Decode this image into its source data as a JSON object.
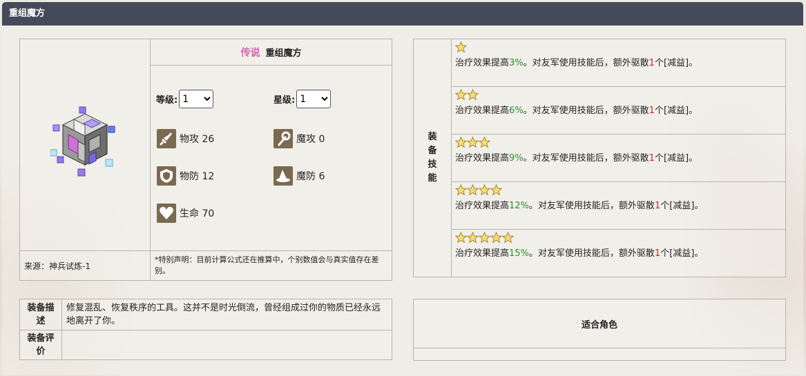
{
  "header": {
    "title": "重组魔方"
  },
  "item": {
    "rarity": "传说",
    "name": "重组魔方",
    "level_label": "等级:",
    "level_value": "1",
    "star_label": "星级:",
    "star_value": "1",
    "stats": {
      "patk": "物攻 26",
      "matk": "魔攻 0",
      "pdef": "物防 12",
      "mdef": "魔防 6",
      "hp": "生命 70"
    },
    "source": "来源：神兵试炼-1",
    "note": "*特别声明：目前计算公式还在推算中，个别数值会与真实值存在差别。"
  },
  "skills": {
    "label": "装备技能",
    "rows": [
      {
        "stars": 1,
        "prefix": "治疗效果提高",
        "pct": "3%",
        "middle": "。对友军使用技能后，额外驱散",
        "count": "1",
        "suffix": "个[减益]。"
      },
      {
        "stars": 2,
        "prefix": "治疗效果提高",
        "pct": "6%",
        "middle": "。对友军使用技能后，额外驱散",
        "count": "1",
        "suffix": "个[减益]。"
      },
      {
        "stars": 3,
        "prefix": "治疗效果提高",
        "pct": "9%",
        "middle": "。对友军使用技能后，额外驱散",
        "count": "1",
        "suffix": "个[减益]。"
      },
      {
        "stars": 4,
        "prefix": "治疗效果提高",
        "pct": "12%",
        "middle": "。对友军使用技能后，额外驱散",
        "count": "1",
        "suffix": "个[减益]。"
      },
      {
        "stars": 5,
        "prefix": "治疗效果提高",
        "pct": "15%",
        "middle": "。对友军使用技能后，额外驱散",
        "count": "1",
        "suffix": "个[减益]。"
      }
    ]
  },
  "description": {
    "desc_label": "装备描述",
    "desc_text": "修复混乱、恢复秩序的工具。这并不是时光倒流，曾经组成过你的物质已经永远地离开了你。",
    "review_label": "装备评价",
    "review_text": ""
  },
  "roles": {
    "title": "适合角色"
  },
  "colors": {
    "header_bg": "#444a5a",
    "rarity": "#d26bb1",
    "pct": "#2e8b2e",
    "count": "#cc2222",
    "icon_bg": "#7a6a4f"
  },
  "icons": {
    "patk": "sword-icon",
    "matk": "staff-icon",
    "pdef": "shield-icon",
    "mdef": "hat-icon",
    "hp": "heart-icon",
    "item": "cube-icon",
    "star": "star-icon"
  }
}
